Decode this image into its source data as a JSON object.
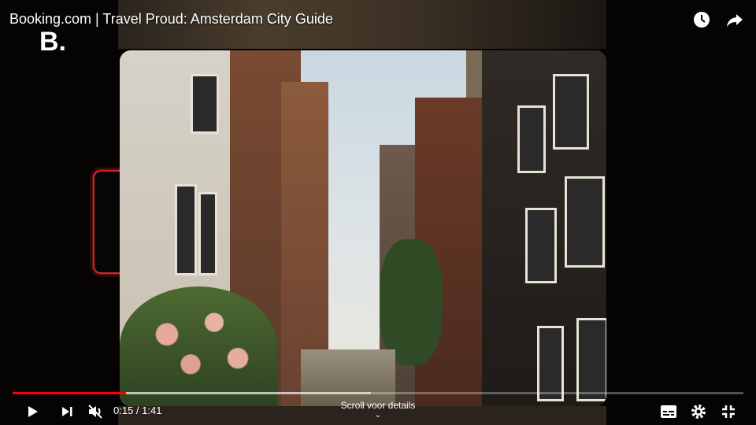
{
  "video": {
    "title": "Booking.com | Travel Proud: Amsterdam City Guide",
    "channel_logo": "B.",
    "current_time": "0:15",
    "separator": " / ",
    "duration": "1:41",
    "progress_played": 0.155,
    "progress_buffered": 0.49
  },
  "overlay": {
    "scroll_hint": "Scroll voor details",
    "scroll_icon": "chevron-down-icon"
  },
  "header": {
    "icons": [
      "watch-later-icon",
      "share-icon"
    ]
  },
  "controls": {
    "left_icons": [
      "play-icon",
      "next-icon",
      "mute-icon"
    ],
    "right_icons": [
      "subtitles-icon",
      "settings-icon",
      "exit-fullscreen-icon"
    ]
  },
  "colors": {
    "progress": "#ff0000",
    "sprocket_glow": "#d1232a"
  }
}
